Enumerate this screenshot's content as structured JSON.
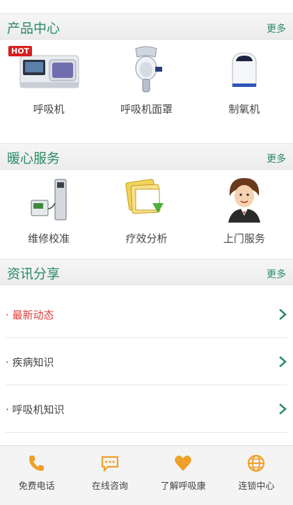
{
  "products": {
    "title": "产品中心",
    "more": "更多",
    "hot_badge": "HOT",
    "items": [
      {
        "label": "呼吸机",
        "icon": "ventilator-icon"
      },
      {
        "label": "呼吸机面罩",
        "icon": "mask-icon"
      },
      {
        "label": "制氧机",
        "icon": "oxygen-concentrator-icon"
      }
    ]
  },
  "services": {
    "title": "暖心服务",
    "more": "更多",
    "items": [
      {
        "label": "维修校准",
        "icon": "calibration-device-icon"
      },
      {
        "label": "疗效分析",
        "icon": "data-analysis-icon"
      },
      {
        "label": "上门服务",
        "icon": "service-person-icon"
      }
    ]
  },
  "news": {
    "title": "资讯分享",
    "more": "更多",
    "items": [
      {
        "label": "· 最新动态",
        "active": true
      },
      {
        "label": "· 疾病知识",
        "active": false
      },
      {
        "label": "· 呼吸机知识",
        "active": false
      }
    ]
  },
  "bottom_nav": [
    {
      "label": "免费电话",
      "icon": "phone-icon"
    },
    {
      "label": "在线咨询",
      "icon": "chat-icon"
    },
    {
      "label": "了解呼吸康",
      "icon": "heart-icon"
    },
    {
      "label": "连锁中心",
      "icon": "globe-icon"
    }
  ],
  "colors": {
    "accent_green": "#2a8a64",
    "active_red": "#e03a3a",
    "icon_orange": "#f0a028",
    "hot_red": "#d81e1e"
  }
}
